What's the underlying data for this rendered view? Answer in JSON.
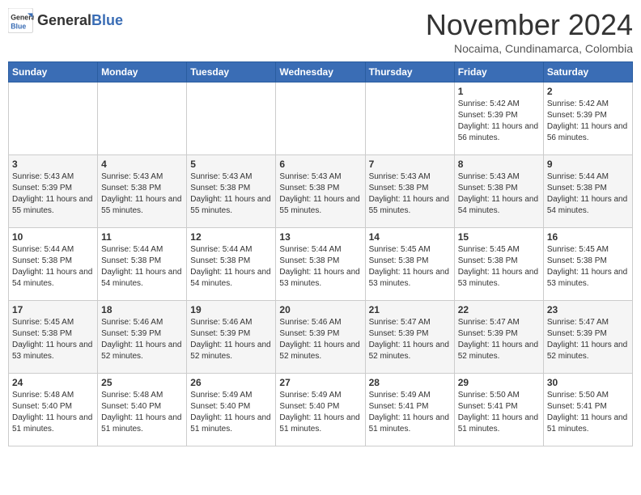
{
  "header": {
    "logo_general": "General",
    "logo_blue": "Blue",
    "month_title": "November 2024",
    "location": "Nocaima, Cundinamarca, Colombia"
  },
  "weekdays": [
    "Sunday",
    "Monday",
    "Tuesday",
    "Wednesday",
    "Thursday",
    "Friday",
    "Saturday"
  ],
  "weeks": [
    [
      {
        "day": "",
        "info": ""
      },
      {
        "day": "",
        "info": ""
      },
      {
        "day": "",
        "info": ""
      },
      {
        "day": "",
        "info": ""
      },
      {
        "day": "",
        "info": ""
      },
      {
        "day": "1",
        "info": "Sunrise: 5:42 AM\nSunset: 5:39 PM\nDaylight: 11 hours and 56 minutes."
      },
      {
        "day": "2",
        "info": "Sunrise: 5:42 AM\nSunset: 5:39 PM\nDaylight: 11 hours and 56 minutes."
      }
    ],
    [
      {
        "day": "3",
        "info": "Sunrise: 5:43 AM\nSunset: 5:39 PM\nDaylight: 11 hours and 55 minutes."
      },
      {
        "day": "4",
        "info": "Sunrise: 5:43 AM\nSunset: 5:38 PM\nDaylight: 11 hours and 55 minutes."
      },
      {
        "day": "5",
        "info": "Sunrise: 5:43 AM\nSunset: 5:38 PM\nDaylight: 11 hours and 55 minutes."
      },
      {
        "day": "6",
        "info": "Sunrise: 5:43 AM\nSunset: 5:38 PM\nDaylight: 11 hours and 55 minutes."
      },
      {
        "day": "7",
        "info": "Sunrise: 5:43 AM\nSunset: 5:38 PM\nDaylight: 11 hours and 55 minutes."
      },
      {
        "day": "8",
        "info": "Sunrise: 5:43 AM\nSunset: 5:38 PM\nDaylight: 11 hours and 54 minutes."
      },
      {
        "day": "9",
        "info": "Sunrise: 5:44 AM\nSunset: 5:38 PM\nDaylight: 11 hours and 54 minutes."
      }
    ],
    [
      {
        "day": "10",
        "info": "Sunrise: 5:44 AM\nSunset: 5:38 PM\nDaylight: 11 hours and 54 minutes."
      },
      {
        "day": "11",
        "info": "Sunrise: 5:44 AM\nSunset: 5:38 PM\nDaylight: 11 hours and 54 minutes."
      },
      {
        "day": "12",
        "info": "Sunrise: 5:44 AM\nSunset: 5:38 PM\nDaylight: 11 hours and 54 minutes."
      },
      {
        "day": "13",
        "info": "Sunrise: 5:44 AM\nSunset: 5:38 PM\nDaylight: 11 hours and 53 minutes."
      },
      {
        "day": "14",
        "info": "Sunrise: 5:45 AM\nSunset: 5:38 PM\nDaylight: 11 hours and 53 minutes."
      },
      {
        "day": "15",
        "info": "Sunrise: 5:45 AM\nSunset: 5:38 PM\nDaylight: 11 hours and 53 minutes."
      },
      {
        "day": "16",
        "info": "Sunrise: 5:45 AM\nSunset: 5:38 PM\nDaylight: 11 hours and 53 minutes."
      }
    ],
    [
      {
        "day": "17",
        "info": "Sunrise: 5:45 AM\nSunset: 5:38 PM\nDaylight: 11 hours and 53 minutes."
      },
      {
        "day": "18",
        "info": "Sunrise: 5:46 AM\nSunset: 5:39 PM\nDaylight: 11 hours and 52 minutes."
      },
      {
        "day": "19",
        "info": "Sunrise: 5:46 AM\nSunset: 5:39 PM\nDaylight: 11 hours and 52 minutes."
      },
      {
        "day": "20",
        "info": "Sunrise: 5:46 AM\nSunset: 5:39 PM\nDaylight: 11 hours and 52 minutes."
      },
      {
        "day": "21",
        "info": "Sunrise: 5:47 AM\nSunset: 5:39 PM\nDaylight: 11 hours and 52 minutes."
      },
      {
        "day": "22",
        "info": "Sunrise: 5:47 AM\nSunset: 5:39 PM\nDaylight: 11 hours and 52 minutes."
      },
      {
        "day": "23",
        "info": "Sunrise: 5:47 AM\nSunset: 5:39 PM\nDaylight: 11 hours and 52 minutes."
      }
    ],
    [
      {
        "day": "24",
        "info": "Sunrise: 5:48 AM\nSunset: 5:40 PM\nDaylight: 11 hours and 51 minutes."
      },
      {
        "day": "25",
        "info": "Sunrise: 5:48 AM\nSunset: 5:40 PM\nDaylight: 11 hours and 51 minutes."
      },
      {
        "day": "26",
        "info": "Sunrise: 5:49 AM\nSunset: 5:40 PM\nDaylight: 11 hours and 51 minutes."
      },
      {
        "day": "27",
        "info": "Sunrise: 5:49 AM\nSunset: 5:40 PM\nDaylight: 11 hours and 51 minutes."
      },
      {
        "day": "28",
        "info": "Sunrise: 5:49 AM\nSunset: 5:41 PM\nDaylight: 11 hours and 51 minutes."
      },
      {
        "day": "29",
        "info": "Sunrise: 5:50 AM\nSunset: 5:41 PM\nDaylight: 11 hours and 51 minutes."
      },
      {
        "day": "30",
        "info": "Sunrise: 5:50 AM\nSunset: 5:41 PM\nDaylight: 11 hours and 51 minutes."
      }
    ]
  ]
}
